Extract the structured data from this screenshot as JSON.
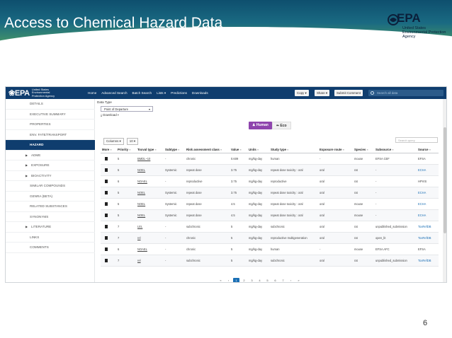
{
  "slide": {
    "title": "Access to Chemical Hazard Data",
    "page_number": "6",
    "logo": {
      "letters": "EPA",
      "org_lines": [
        "United States",
        "Environmental Protection",
        "Agency"
      ]
    }
  },
  "app": {
    "logo_org": "United States Environmental Protection Agency",
    "nav": [
      "Home",
      "Advanced Search",
      "Batch Search",
      "Lists ▾",
      "Predictions",
      "Downloads"
    ],
    "buttons": {
      "copy": "Copy ▾",
      "share": "Share ▾",
      "submit_comment": "Submit Comment"
    },
    "search_placeholder": "Search all data"
  },
  "sidebar": {
    "items": [
      {
        "label": "DETAILS",
        "caret": false,
        "active": false
      },
      {
        "label": "EXECUTIVE SUMMARY",
        "caret": false,
        "active": false
      },
      {
        "label": "PROPERTIES",
        "caret": false,
        "active": false
      },
      {
        "label": "ENV. FATE/TRANSPORT",
        "caret": false,
        "active": false
      },
      {
        "label": "HAZARD",
        "caret": false,
        "active": true
      },
      {
        "label": "ADME",
        "caret": true,
        "active": false
      },
      {
        "label": "EXPOSURE",
        "caret": true,
        "active": false
      },
      {
        "label": "BIOACTIVITY",
        "caret": true,
        "active": false
      },
      {
        "label": "SIMILAR COMPOUNDS",
        "caret": false,
        "active": false
      },
      {
        "label": "GENRA (BETA)",
        "caret": false,
        "active": false
      },
      {
        "label": "RELATED SUBSTANCES",
        "caret": false,
        "active": false
      },
      {
        "label": "SYNONYMS",
        "caret": false,
        "active": false
      },
      {
        "label": "LITERATURE",
        "caret": true,
        "active": false
      },
      {
        "label": "LINKS",
        "caret": false,
        "active": false
      },
      {
        "label": "COMMENTS",
        "caret": false,
        "active": false
      }
    ]
  },
  "content": {
    "data_type_label": "Data Type",
    "select_value": "Point of Departure",
    "download_label": "Download ▾",
    "toggle": {
      "human": "Human",
      "eco": "Eco"
    },
    "columns_label": "Columns ▾",
    "page_size": "10 ▾",
    "grid_search_placeholder": "Search query"
  },
  "table": {
    "headers": [
      "More",
      "Priority",
      "Toxval type",
      "Subtype",
      "Risk assessment class",
      "Value",
      "Units",
      "Study type",
      "Exposure route",
      "Species",
      "Subsource",
      "Source"
    ],
    "rows": [
      [
        "",
        "5",
        "BMDL~10",
        "-",
        "chronic",
        "0.609",
        "mg/kg-day",
        "human",
        "-",
        "mouse",
        "EFSA CEF",
        "EFSA"
      ],
      [
        "",
        "5",
        "NOEL",
        "Systemic",
        "repeat dose",
        "3.75",
        "mg/kg-day",
        "repeat dose toxicity : oral",
        "oral",
        "rat",
        "-",
        "ECHA"
      ],
      [
        "",
        "6",
        "NOAEL",
        "-",
        "reproductive",
        "3.75",
        "mg/kg-day",
        "reproductive",
        "oral",
        "rat",
        "-",
        "HPVIS"
      ],
      [
        "",
        "5",
        "NOEL",
        "Systemic",
        "repeat dose",
        "3.75",
        "mg/kg-day",
        "repeat dose toxicity : oral",
        "oral",
        "rat",
        "-",
        "ECHA"
      ],
      [
        "",
        "5",
        "NOEL",
        "Systemic",
        "repeat dose",
        "4.5",
        "mg/kg-day",
        "repeat dose toxicity : oral",
        "oral",
        "mouse",
        "-",
        "ECHA"
      ],
      [
        "",
        "5",
        "NOEL",
        "Systemic",
        "repeat dose",
        "4.5",
        "mg/kg-day",
        "repeat dose toxicity : oral",
        "oral",
        "mouse",
        "-",
        "ECHA"
      ],
      [
        "",
        "7",
        "LEL",
        "-",
        "subchronic",
        "5",
        "mg/kg-day",
        "subchronic",
        "oral",
        "rat",
        "unpublished_submission",
        "ToxRefDB"
      ],
      [
        "",
        "7",
        "rel",
        "-",
        "chronic",
        "5",
        "mg/kg-day",
        "reproductive multigeneration",
        "oral",
        "rat",
        "open_lit",
        "ToxRefDB"
      ],
      [
        "",
        "6",
        "NOAEL",
        "-",
        "chronic",
        "5",
        "mg/kg-day",
        "human",
        "-",
        "mouse",
        "EFSA AFC",
        "EFSA"
      ],
      [
        "",
        "7",
        "rel",
        "-",
        "subchronic",
        "5",
        "mg/kg-day",
        "subchronic",
        "oral",
        "rat",
        "unpublished_submission",
        "ToxRefDB"
      ]
    ]
  },
  "pager": [
    "«",
    "‹",
    "1",
    "2",
    "3",
    "4",
    "5",
    "6",
    "7",
    "›",
    "»"
  ]
}
